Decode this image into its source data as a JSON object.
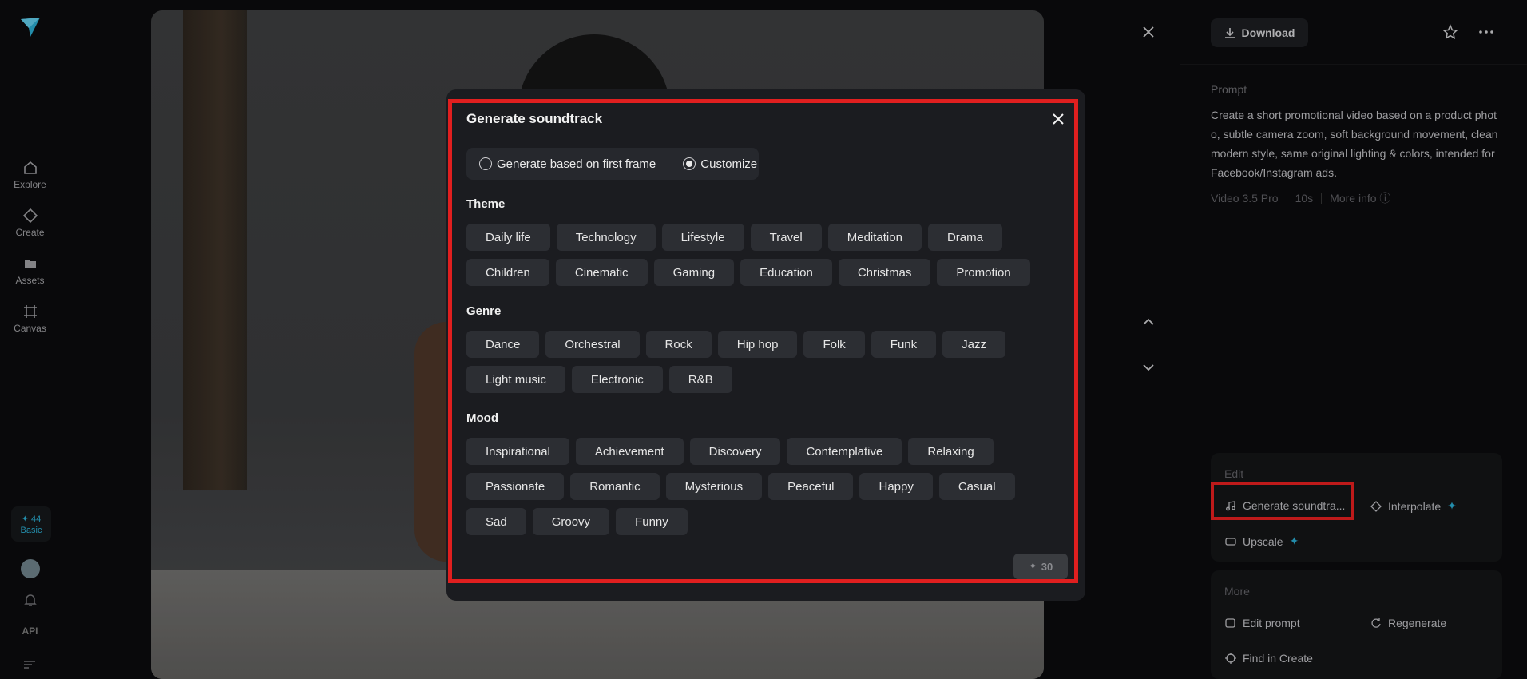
{
  "sidebar": {
    "items": [
      {
        "label": "Explore",
        "icon": "home-icon"
      },
      {
        "label": "Create",
        "icon": "diamond-icon"
      },
      {
        "label": "Assets",
        "icon": "folder-icon"
      },
      {
        "label": "Canvas",
        "icon": "canvas-icon"
      }
    ],
    "credits": {
      "amount": "44",
      "plan": "Basic"
    },
    "api_label": "API"
  },
  "right_panel": {
    "download_label": "Download",
    "prompt_label": "Prompt",
    "prompt_text": "Create a short promotional video based on a product photo, subtle camera zoom, soft background movement, clean modern style, same original lighting & colors, intended for Facebook/Instagram ads.",
    "model": "Video 3.5 Pro",
    "duration": "10s",
    "more_info": "More info",
    "edit_title": "Edit",
    "edit_actions": {
      "soundtrack": "Generate soundtra...",
      "interpolate": "Interpolate",
      "upscale": "Upscale"
    },
    "more_title": "More",
    "more_actions": {
      "edit_prompt": "Edit prompt",
      "regenerate": "Regenerate",
      "find_in_create": "Find in Create"
    }
  },
  "modal": {
    "title": "Generate soundtrack",
    "options": {
      "first_frame": "Generate based on first frame",
      "customize": "Customize",
      "selected": "customize"
    },
    "theme_label": "Theme",
    "theme_rows": [
      [
        "Daily life",
        "Technology",
        "Lifestyle",
        "Travel",
        "Meditation",
        "Drama"
      ],
      [
        "Children",
        "Cinematic",
        "Gaming",
        "Education",
        "Christmas",
        "Promotion"
      ]
    ],
    "genre_label": "Genre",
    "genre_rows": [
      [
        "Dance",
        "Orchestral",
        "Rock",
        "Hip hop",
        "Folk",
        "Funk",
        "Jazz"
      ],
      [
        "Light music",
        "Electronic",
        "R&B"
      ]
    ],
    "mood_label": "Mood",
    "mood_rows": [
      [
        "Inspirational",
        "Achievement",
        "Discovery",
        "Contemplative",
        "Relaxing"
      ],
      [
        "Passionate",
        "Romantic",
        "Mysterious",
        "Peaceful",
        "Happy",
        "Casual"
      ],
      [
        "Sad",
        "Groovy",
        "Funny"
      ]
    ],
    "generate_cost": "30"
  },
  "colors": {
    "accent": "#2aa6c9",
    "highlight": "#e01f1f",
    "modal_bg": "#1b1c20",
    "chip_bg": "#2c2e33"
  }
}
